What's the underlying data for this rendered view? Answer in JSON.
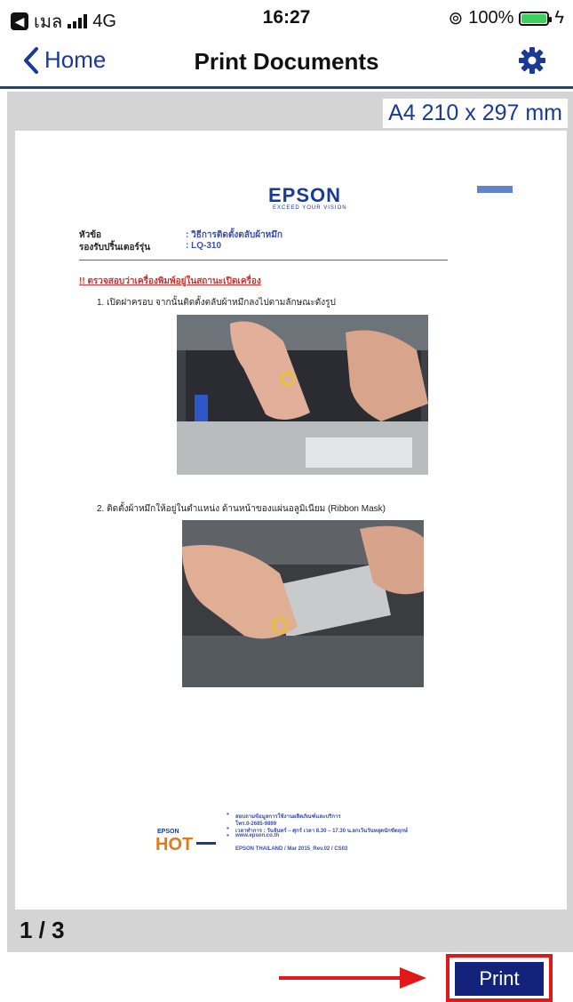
{
  "status_bar": {
    "carrier": "เมล",
    "network": "4G",
    "time": "16:27",
    "battery": "100%",
    "battery_level": 1.0
  },
  "nav": {
    "back_label": "Home",
    "title": "Print Documents",
    "settings_icon": "gear-icon"
  },
  "preview": {
    "paper_size": "A4 210 x 297 mm",
    "page_counter": "1 / 3",
    "document": {
      "logo": "EPSON",
      "logo_sub": "EXCEED YOUR VISION",
      "header_rows": [
        {
          "key": "หัวข้อ",
          "value": ": วิธีการติดตั้งตลับผ้าหมึก"
        },
        {
          "key": "รองรับปริ้นเตอร์รุ่น",
          "value": ": LQ-310"
        }
      ],
      "warning": "!! ตรวจสอบว่าเครื่องพิมพ์อยู่ในสถานะเปิดเครื่อง",
      "step1": "1.  เปิดฝาครอบ  จากนั้นติดตั้งตลับผ้าหมึกลงไปตามลักษณะดังรูป",
      "step2": "2.  ติดตั้งผ้าหมึกให้อยู่ในตำแหน่ง  ด้านหน้าของแผ่นอลูมิเนียม (Ribbon  Mask)",
      "footer_logo": "EPSON HOT",
      "footer_lines": [
        "สอบถามข้อมูลการใช้งานผลิตภัณฑ์และบริการ",
        "โทร.0-2685-9899",
        "เวลาทำการ : วันจันทร์ – ศุกร์ เวลา 8.30 – 17.30 น.ยกเว้นวันหยุดนักขัตฤกษ์",
        "www.epson.co.th"
      ],
      "footer_doc_id": "EPSON THAILAND / Mar 2015_Rev.02 / CS03"
    }
  },
  "actions": {
    "print_label": "Print"
  },
  "colors": {
    "accent": "#1a3a95",
    "print_button": "#13237c",
    "highlight": "#e01818"
  }
}
